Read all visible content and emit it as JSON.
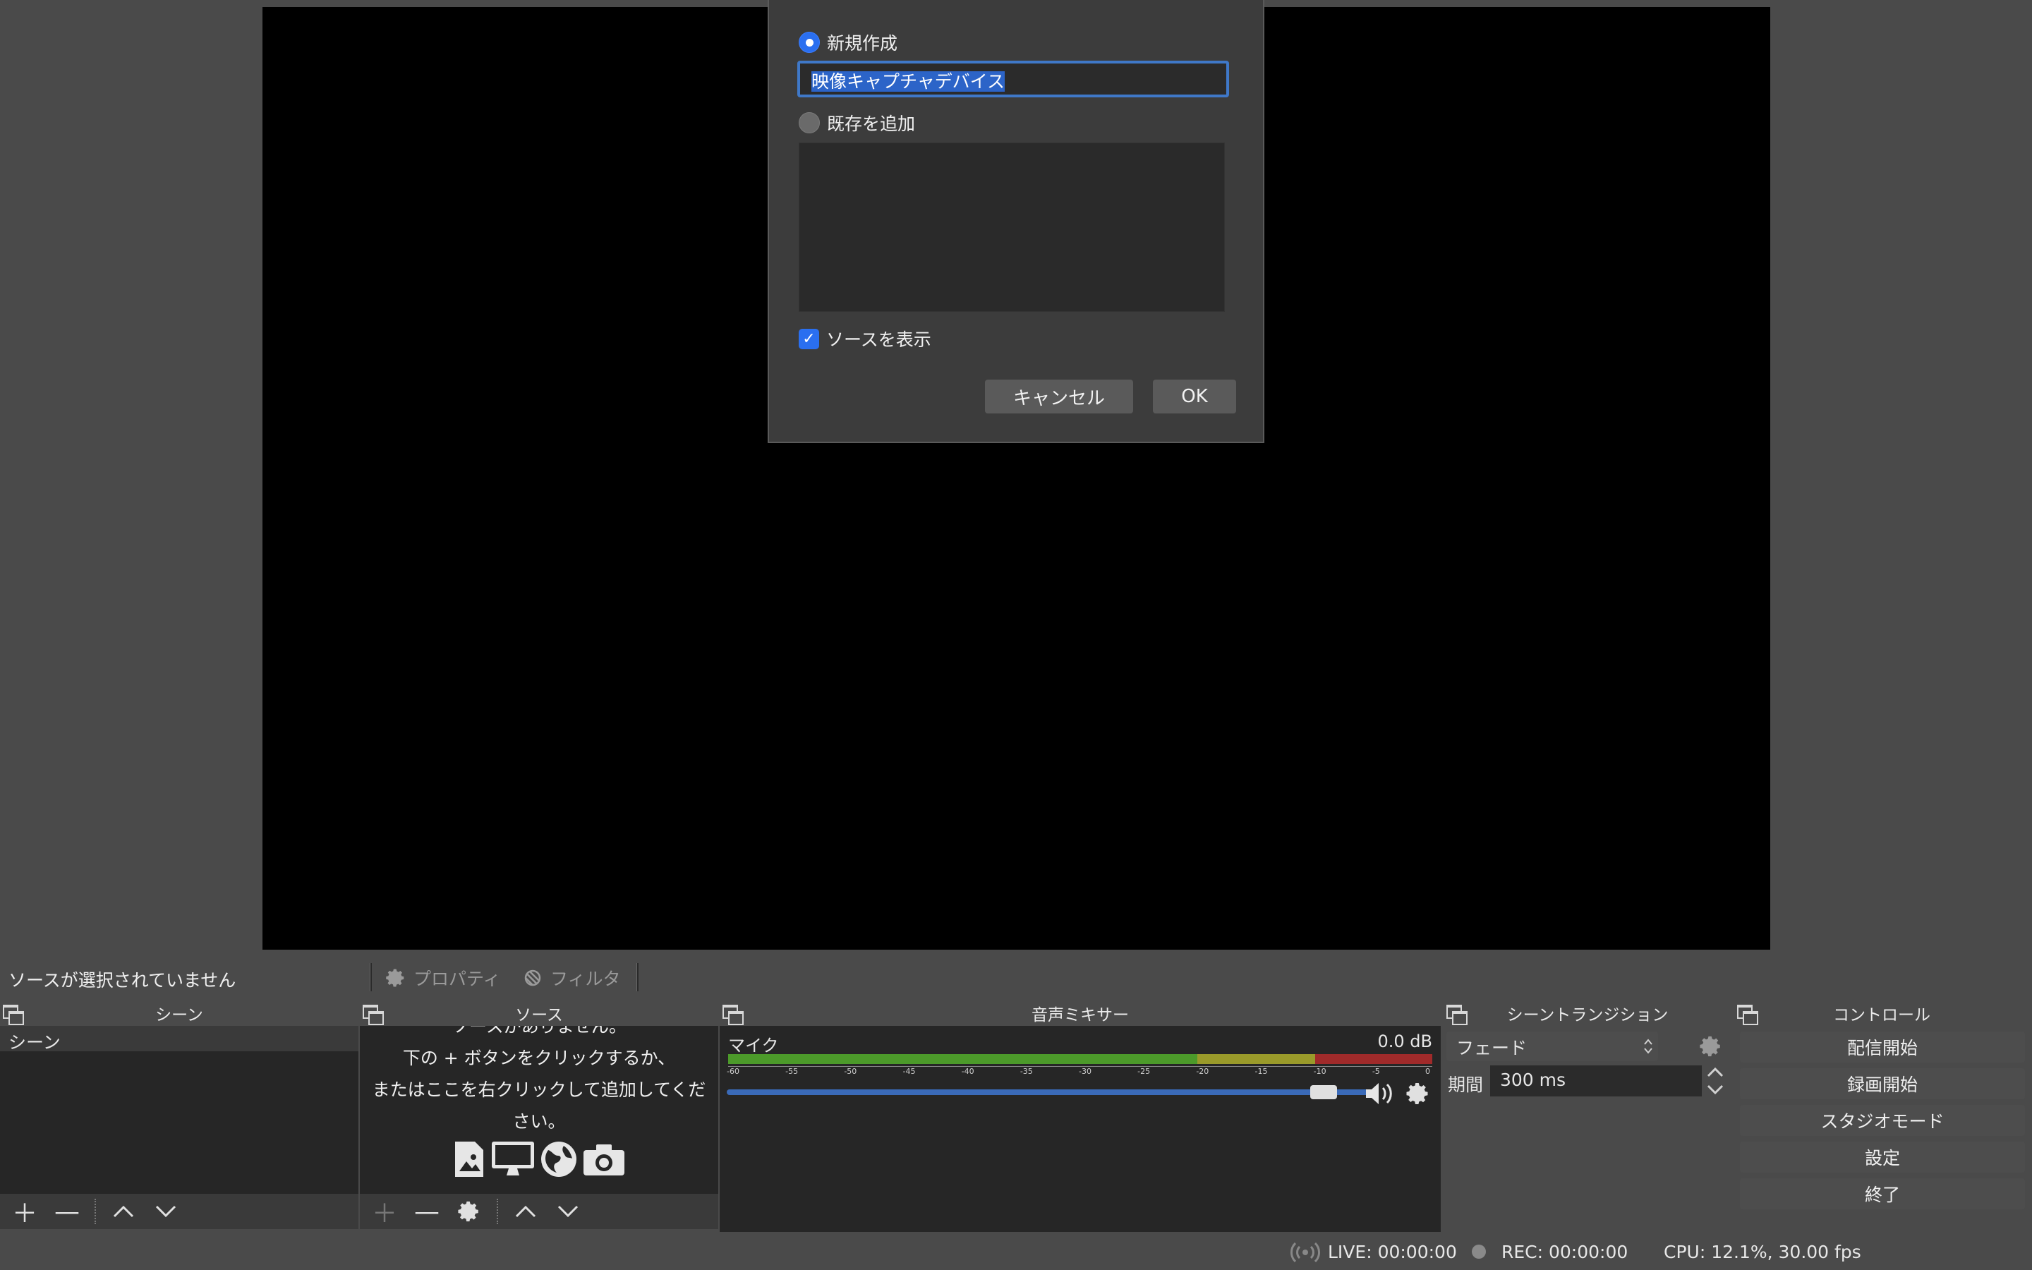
{
  "dialog": {
    "radio_new": "新規作成",
    "name_value": "映像キャプチャデバイス",
    "radio_existing": "既存を追加",
    "show_source": "ソースを表示",
    "cancel": "キャンセル",
    "ok": "OK"
  },
  "context": {
    "no_source": "ソースが選択されていません",
    "properties": "プロパティ",
    "filters": "フィルタ"
  },
  "scenes": {
    "title": "シーン",
    "items": [
      "シーン"
    ]
  },
  "sources": {
    "title": "ソース",
    "empty_line1": "ソースがありません。",
    "empty_line2": "下の + ボタンをクリックするか、",
    "empty_line3": "またはここを右クリックして追加してくだ",
    "empty_line4": "さい。"
  },
  "mixer": {
    "title": "音声ミキサー",
    "channel": "マイク",
    "level": "0.0 dB",
    "ticks": [
      "-60",
      "-55",
      "-50",
      "-45",
      "-40",
      "-35",
      "-30",
      "-25",
      "-20",
      "-15",
      "-10",
      "-5",
      "0"
    ],
    "volume_fraction": 0.95
  },
  "transitions": {
    "title": "シーントランジション",
    "selected": "フェード",
    "duration_label": "期間",
    "duration_value": "300 ms"
  },
  "controls": {
    "title": "コントロール",
    "start_streaming": "配信開始",
    "start_recording": "録画開始",
    "studio_mode": "スタジオモード",
    "settings": "設定",
    "exit": "終了"
  },
  "status": {
    "live": "LIVE: 00:00:00",
    "rec": "REC: 00:00:00",
    "cpu": "CPU: 12.1%, 30.00 fps"
  },
  "colors": {
    "accent": "#2a6ff0",
    "meter_green": "#4c9a2a",
    "meter_yellow": "#9a9a2a",
    "meter_red": "#a02a2a"
  }
}
